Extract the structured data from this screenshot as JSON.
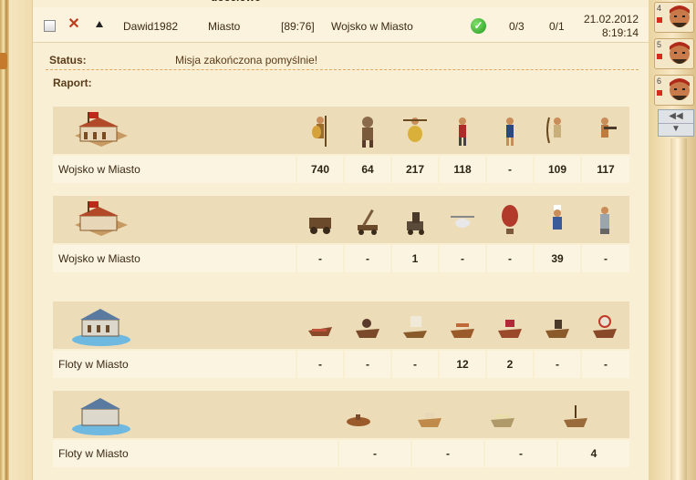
{
  "header": {
    "clipped_title": "docelowe"
  },
  "message": {
    "player": "Dawid1982",
    "city": "Miasto",
    "coords": "[89:76]",
    "subject": "Wojsko w Miasto",
    "count_a": "0/3",
    "count_b": "0/1",
    "date": "21.02.2012",
    "time": "8:19:14"
  },
  "status": {
    "label": "Status:",
    "text": "Misja zakończona pomyślnie!"
  },
  "report": {
    "label": "Raport:"
  },
  "tables": [
    {
      "name": "Wojsko w Miasto",
      "values": [
        "740",
        "64",
        "217",
        "118",
        "-",
        "109",
        "117"
      ]
    },
    {
      "name": "Wojsko w Miasto",
      "values": [
        "-",
        "-",
        "1",
        "-",
        "-",
        "39",
        "-"
      ]
    },
    {
      "name": "Floty w Miasto",
      "values": [
        "-",
        "-",
        "-",
        "12",
        "2",
        "-",
        "-"
      ]
    },
    {
      "name": "Floty w Miasto",
      "values": [
        "-",
        "-",
        "-",
        "4"
      ]
    }
  ],
  "right_panel": {
    "slots": [
      {
        "num": "4"
      },
      {
        "num": "5"
      },
      {
        "num": "6"
      }
    ],
    "nav_up": "◀◀",
    "nav_down": "▼"
  },
  "colors": {
    "accent": "#e0a761",
    "cell": "#fbf4e1",
    "band": "#ecdcb7"
  }
}
